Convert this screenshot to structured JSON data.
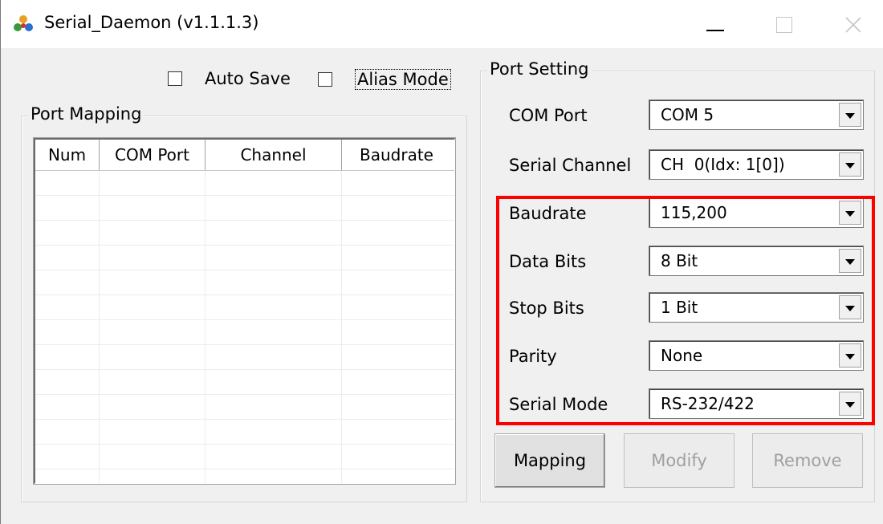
{
  "window": {
    "title": "Serial_Daemon (v1.1.1.3)"
  },
  "options": {
    "auto_save_label": "Auto Save",
    "alias_mode_label": "Alias Mode"
  },
  "port_mapping": {
    "title": "Port Mapping",
    "columns": [
      "Num",
      "COM Port",
      "Channel",
      "Baudrate"
    ]
  },
  "port_setting": {
    "title": "Port Setting",
    "com_port": {
      "label": "COM Port",
      "value": "COM 5"
    },
    "serial_channel": {
      "label": "Serial Channel",
      "value": "CH  0(Idx: 1[0])"
    },
    "baudrate": {
      "label": "Baudrate",
      "value": "115,200"
    },
    "data_bits": {
      "label": "Data Bits",
      "value": "8 Bit"
    },
    "stop_bits": {
      "label": "Stop Bits",
      "value": "1 Bit"
    },
    "parity": {
      "label": "Parity",
      "value": "None"
    },
    "serial_mode": {
      "label": "Serial Mode",
      "value": "RS-232/422"
    }
  },
  "buttons": {
    "mapping": "Mapping",
    "modify": "Modify",
    "remove": "Remove"
  },
  "colors": {
    "highlight": "#ff0000"
  }
}
